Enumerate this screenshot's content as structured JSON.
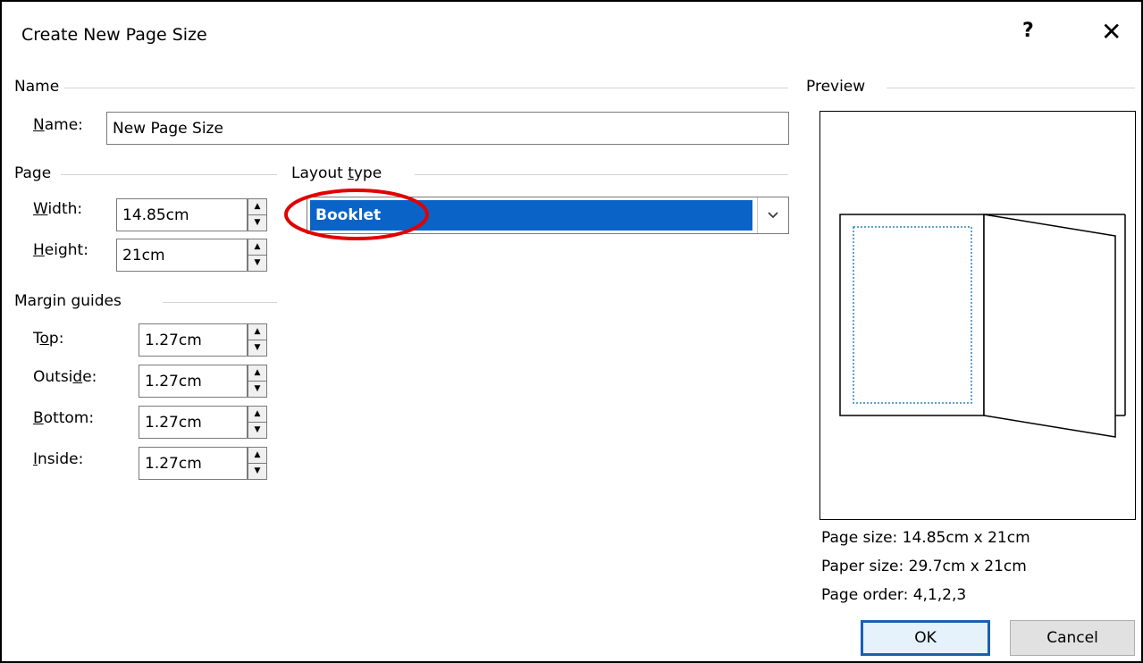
{
  "dialog": {
    "title": "Create New Page Size",
    "help_glyph": "?",
    "close_glyph": "✕"
  },
  "name_group": {
    "label": "Name",
    "name_label_u": "N",
    "name_label_rest": "ame:",
    "name_value": "New Page Size"
  },
  "page_group": {
    "label": "Page",
    "width_label_u": "W",
    "width_label_rest": "idth:",
    "width_value": "14.85cm",
    "height_label_u": "H",
    "height_label_rest": "eight:",
    "height_value": "21cm"
  },
  "layout_group": {
    "label_pre": "Layout ",
    "label_u": "t",
    "label_post": "ype",
    "selected": "Booklet",
    "highlight_color": "#0a64c8",
    "annotation_color": "#e00000"
  },
  "margin_group": {
    "label": "Margin guides",
    "top_label_pre": "T",
    "top_label_u": "o",
    "top_label_post": "p:",
    "top_value": "1.27cm",
    "outside_label_pre": "Outsi",
    "outside_label_u": "d",
    "outside_label_post": "e:",
    "outside_value": "1.27cm",
    "bottom_label_u": "B",
    "bottom_label_rest": "ottom:",
    "bottom_value": "1.27cm",
    "inside_label_u": "I",
    "inside_label_rest": "nside:",
    "inside_value": "1.27cm"
  },
  "preview": {
    "label": "Preview",
    "page_size": "Page size: 14.85cm x 21cm",
    "paper_size": "Paper size: 29.7cm x 21cm",
    "page_order": "Page order: 4,1,2,3"
  },
  "buttons": {
    "ok": "OK",
    "cancel": "Cancel"
  }
}
